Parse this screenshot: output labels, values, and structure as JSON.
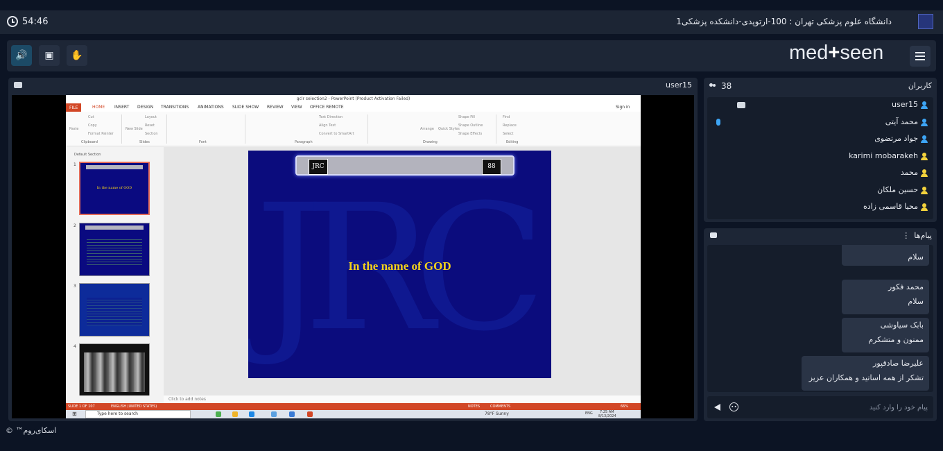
{
  "topbar": {
    "timer": "54:46",
    "room_title": "دانشگاه علوم پزشکی تهران : 100-ارتوپدی-دانشکده پزشکی1"
  },
  "controls": {
    "speaker": "speaker-icon",
    "share": "share-icon",
    "hand": "raise-hand-icon",
    "brand_left": "med",
    "brand_plus": "+",
    "brand_right": "seen"
  },
  "stage": {
    "presenter": "user15"
  },
  "ppt": {
    "window_title": "gclr selection2 - PowerPoint (Product Activation Failed)",
    "tabs": [
      "FILE",
      "HOME",
      "INSERT",
      "DESIGN",
      "TRANSITIONS",
      "ANIMATIONS",
      "SLIDE SHOW",
      "REVIEW",
      "VIEW",
      "OFFICE REMOTE"
    ],
    "sign_in": "Sign in",
    "ribbon_groups": [
      "Clipboard",
      "Slides",
      "Font",
      "Paragraph",
      "Drawing",
      "Editing"
    ],
    "ribbon_items": {
      "paste": "Paste",
      "cut": "Cut",
      "copy": "Copy",
      "format_painter": "Format Painter",
      "new_slide": "New Slide",
      "layout": "Layout",
      "reset": "Reset",
      "section": "Section",
      "text_direction": "Text Direction",
      "align_text": "Align Text",
      "smartart": "Convert to SmartArt",
      "arrange": "Arrange",
      "quick_styles": "Quick Styles",
      "shape_fill": "Shape Fill",
      "shape_outline": "Shape Outline",
      "shape_effects": "Shape Effects",
      "find": "Find",
      "replace": "Replace",
      "select": "Select"
    },
    "section_label": "Default Section",
    "thumbnails": [
      {
        "num": "1",
        "text": "In the name of GOD"
      },
      {
        "num": "2",
        "text": ""
      },
      {
        "num": "3",
        "text": ""
      },
      {
        "num": "4",
        "text": ""
      }
    ],
    "slide_title": "In the name of GOD",
    "slide_logo_left": "JRC",
    "slide_logo_right": "88",
    "notes_placeholder": "Click to add notes",
    "status_slide": "SLIDE 1 OF 107",
    "status_lang": "ENGLISH (UNITED STATES)",
    "status_notes": "NOTES",
    "status_comments": "COMMENTS",
    "status_zoom": "66%",
    "taskbar_search": "Type here to search",
    "weather": "78°F Sunny",
    "lang": "ENG",
    "time": "7:25 AM",
    "date": "8/13/2024"
  },
  "users": {
    "count": "38",
    "title": "کاربران",
    "list": [
      {
        "name": "user15",
        "color": "#3da5f5"
      },
      {
        "name": "محمد آیتی",
        "color": "#3da5f5"
      },
      {
        "name": "جواد مرتضوی",
        "color": "#3da5f5"
      },
      {
        "name": "karimi mobarakeh",
        "color": "#f2d23c"
      },
      {
        "name": "محمد",
        "color": "#f2d23c"
      },
      {
        "name": "حسین ملکان",
        "color": "#f2d23c"
      },
      {
        "name": "محیا قاسمی زاده",
        "color": "#f2d23c"
      }
    ]
  },
  "chat": {
    "title": "پیام‌ها",
    "messages": [
      {
        "who": "",
        "text": "سلام"
      },
      {
        "who": "محمد فکور",
        "text": "سلام"
      },
      {
        "who": "بابک سیاوشی",
        "text": "ممنون و متشکرم"
      },
      {
        "who": "علیرضا صادقپور",
        "text": "تشکر از همه اساتید و همکاران عزیز"
      }
    ],
    "placeholder": "پیام خود را وارد کنید"
  },
  "footer": "اسکای‌روم™ ©"
}
